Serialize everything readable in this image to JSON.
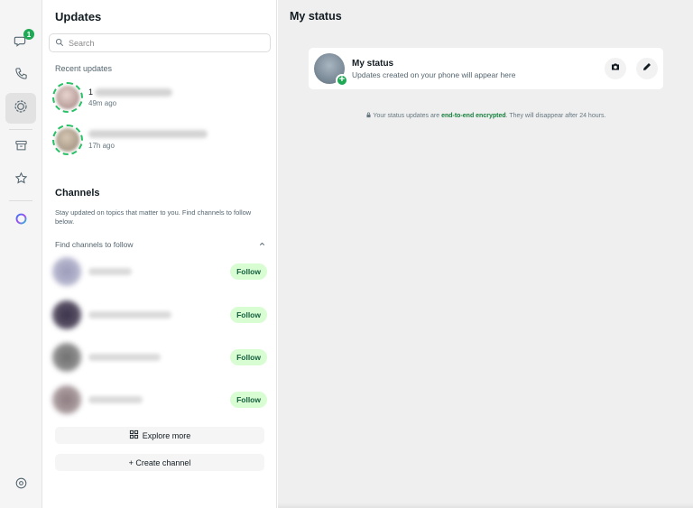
{
  "window": {
    "controls": [
      {
        "name": "close",
        "color": "#fe5f57"
      },
      {
        "name": "minimize",
        "color": "#febc2e"
      },
      {
        "name": "zoom",
        "color": "#28c840"
      }
    ]
  },
  "rail": {
    "chats_badge": "1",
    "icons": [
      "chats-icon",
      "calls-icon",
      "status-icon",
      "archive-icon",
      "starred-icon",
      "meta-ai-icon",
      "settings-icon"
    ]
  },
  "updates": {
    "title": "Updates",
    "search_placeholder": "Search",
    "recent_label": "Recent updates",
    "recent": [
      {
        "name_hint": "1",
        "time": "49m ago"
      },
      {
        "name_hint": "",
        "time": "17h ago"
      }
    ],
    "channels_title": "Channels",
    "channels_desc": "Stay updated on topics that matter to you. Find channels to follow below.",
    "find_label": "Find channels to follow",
    "channels": [
      {
        "follow_label": "Follow"
      },
      {
        "follow_label": "Follow"
      },
      {
        "follow_label": "Follow"
      },
      {
        "follow_label": "Follow"
      }
    ],
    "explore_label": "Explore more",
    "create_label": "+ Create channel"
  },
  "main": {
    "title": "My status",
    "my_status_title": "My status",
    "my_status_sub": "Updates created on your phone will appear here",
    "note_before": "Your status updates are ",
    "note_link": "end-to-end encrypted",
    "note_after": ". They will disappear after 24 hours."
  },
  "colors": {
    "accent": "#1fa855",
    "follow_bg": "#d9fdd3",
    "follow_text": "#15603e"
  }
}
